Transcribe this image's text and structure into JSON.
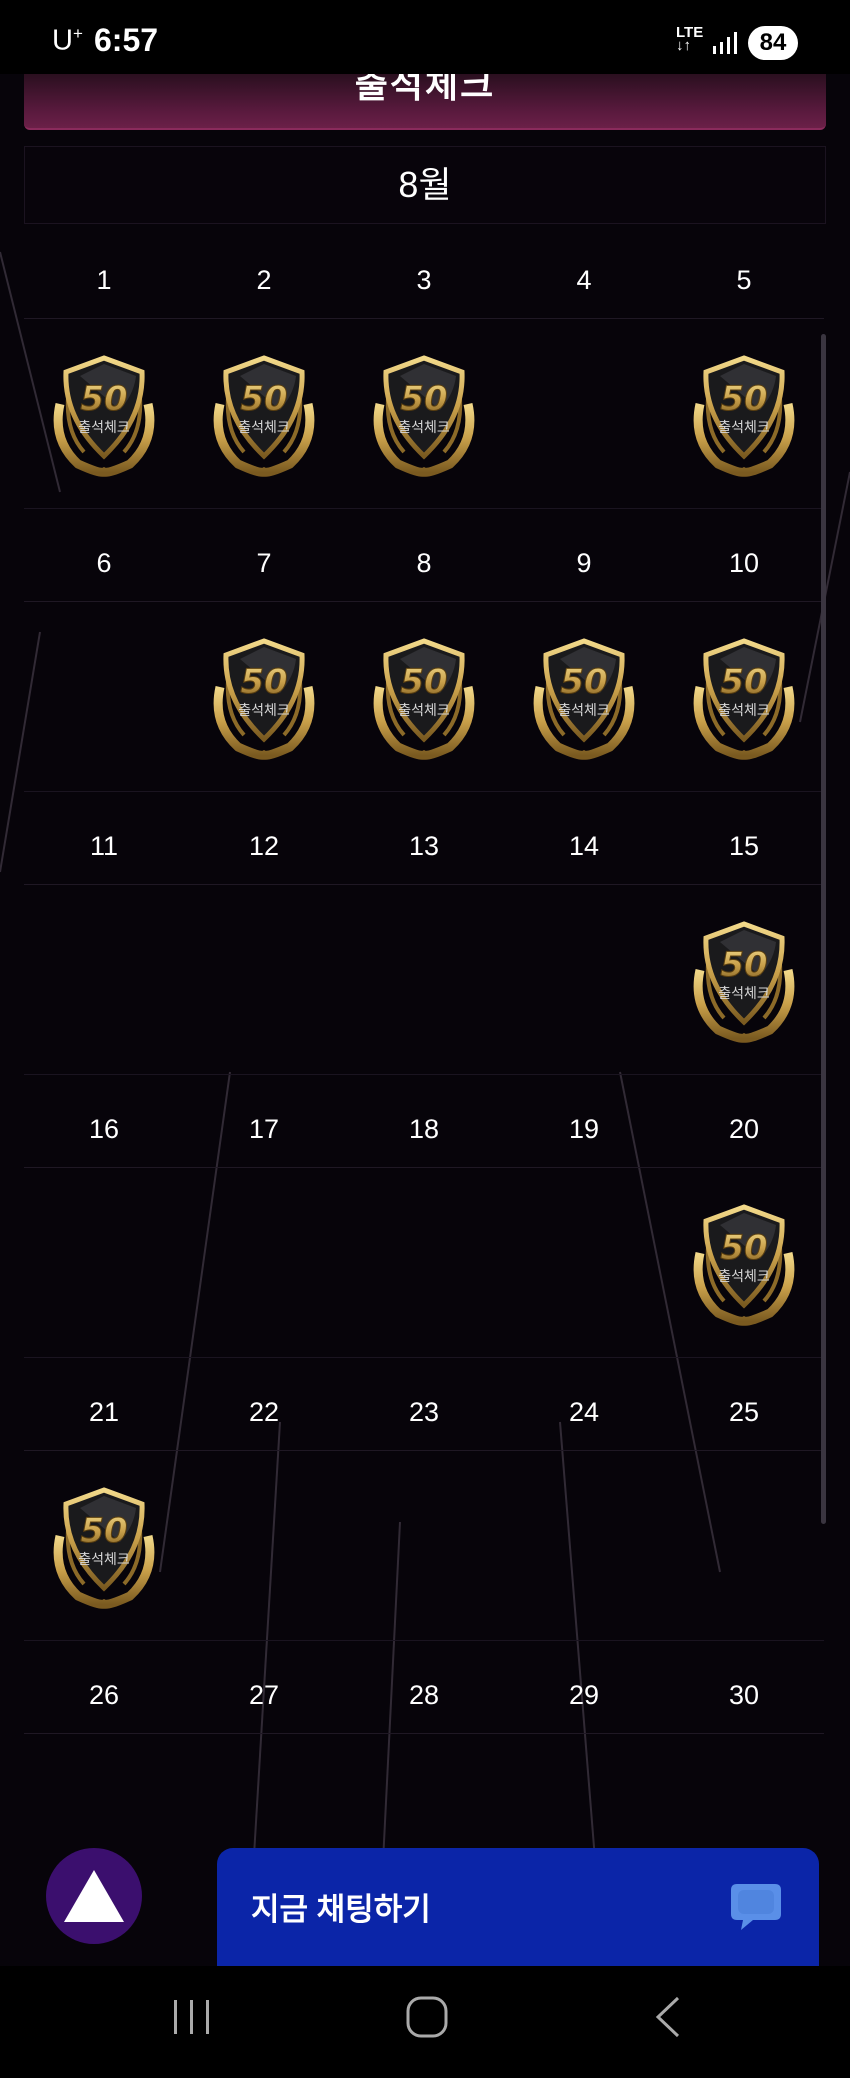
{
  "status_bar": {
    "carrier": "U",
    "carrier_sup": "+",
    "time": "6:57",
    "network_top": "LTE",
    "network_bottom": "↓↑",
    "battery": "84"
  },
  "page": {
    "title": "출석체크",
    "month": "8월"
  },
  "calendar": {
    "weeks": [
      {
        "days": [
          "1",
          "2",
          "3",
          "4",
          "5"
        ],
        "stamped": [
          true,
          true,
          true,
          false,
          true
        ]
      },
      {
        "days": [
          "6",
          "7",
          "8",
          "9",
          "10"
        ],
        "stamped": [
          false,
          true,
          true,
          true,
          true
        ]
      },
      {
        "days": [
          "11",
          "12",
          "13",
          "14",
          "15"
        ],
        "stamped": [
          false,
          false,
          false,
          false,
          true
        ]
      },
      {
        "days": [
          "16",
          "17",
          "18",
          "19",
          "20"
        ],
        "stamped": [
          false,
          false,
          false,
          false,
          true
        ]
      },
      {
        "days": [
          "21",
          "22",
          "23",
          "24",
          "25"
        ],
        "stamped": [
          true,
          false,
          false,
          false,
          false
        ]
      },
      {
        "days": [
          "26",
          "27",
          "28",
          "29",
          "30"
        ],
        "stamped": [
          false,
          false,
          false,
          false,
          false
        ]
      }
    ]
  },
  "stamp": {
    "number": "50",
    "text": "출석체크"
  },
  "floating": {
    "chat_label": "지금 채팅하기",
    "icons": {
      "home": "triangle-icon",
      "chat": "chat-bubble-icon"
    }
  },
  "nav_bar": {
    "icons": [
      "recent-apps-icon",
      "home-icon",
      "back-icon"
    ]
  },
  "colors": {
    "background": "#07040a",
    "banner": "#5a1a3e",
    "chat_button": "#0b25a8",
    "floating_circle": "#3b0f6e",
    "stamp_gold": "#c9a04a"
  }
}
